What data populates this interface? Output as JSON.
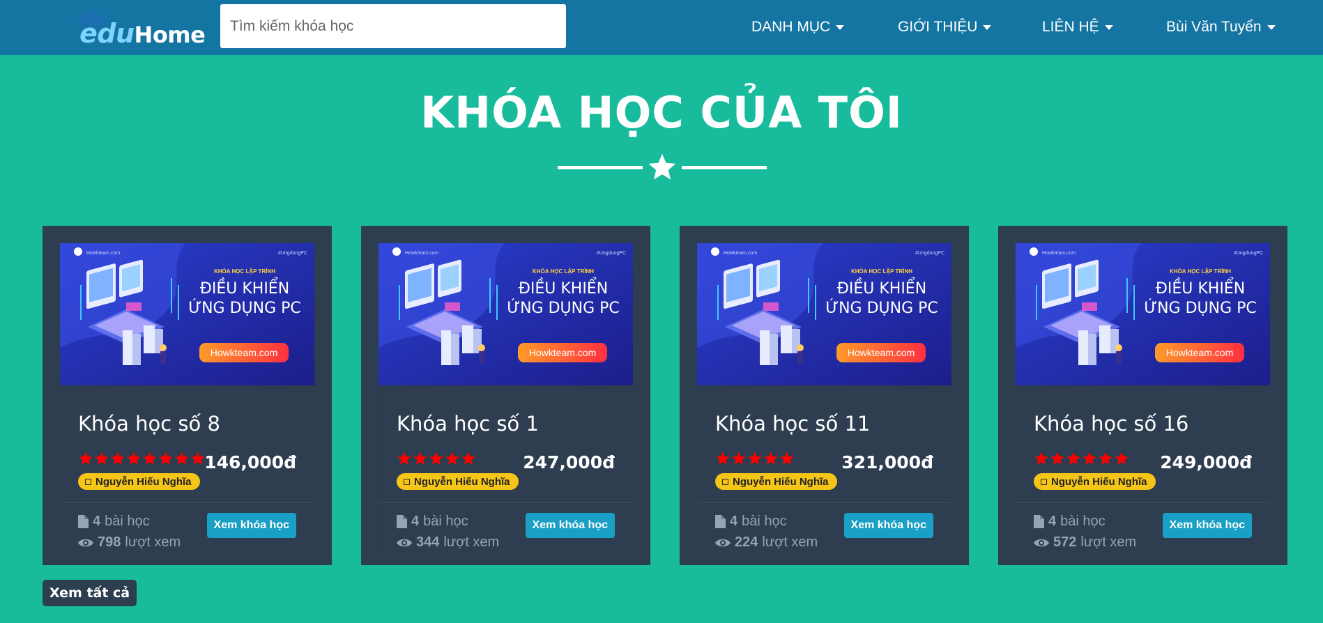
{
  "brand": {
    "logo_prefix": "edu",
    "logo_suffix": "Home"
  },
  "search": {
    "placeholder": "Tìm kiếm khóa học"
  },
  "nav": {
    "items": [
      {
        "label": "DANH MỤC"
      },
      {
        "label": "GIỚI THIỆU"
      },
      {
        "label": "LIÊN HỆ"
      },
      {
        "label": "Bùi Văn Tuyển"
      }
    ]
  },
  "page": {
    "title": "KHÓA HỌC CỦA TÔI"
  },
  "banner": {
    "site_small": "Howkteam.com",
    "hashtag": "#UngdungPC",
    "kicker": "KHÓA HỌC LẬP TRÌNH",
    "line1": "ĐIỀU KHIỂN",
    "line2": "ỨNG DỤNG PC",
    "button": "Howkteam.com"
  },
  "courses": [
    {
      "title": "Khóa học số 8",
      "price": "146,000đ",
      "stars": 8,
      "author": "Nguyễn Hiếu Nghĩa",
      "lessons_num": "4",
      "lessons_label": "bài học",
      "views_num": "798",
      "views_label": "lượt xem",
      "button": "Xem khóa học"
    },
    {
      "title": "Khóa học số 1",
      "price": "247,000đ",
      "stars": 5,
      "author": "Nguyễn Hiếu Nghĩa",
      "lessons_num": "4",
      "lessons_label": "bài học",
      "views_num": "344",
      "views_label": "lượt xem",
      "button": "Xem khóa học"
    },
    {
      "title": "Khóa học số 11",
      "price": "321,000đ",
      "stars": 5,
      "author": "Nguyễn Hiếu Nghĩa",
      "lessons_num": "4",
      "lessons_label": "bài học",
      "views_num": "224",
      "views_label": "lượt xem",
      "button": "Xem khóa học"
    },
    {
      "title": "Khóa học số 16",
      "price": "249,000đ",
      "stars": 6,
      "author": "Nguyễn Hiếu Nghĩa",
      "lessons_num": "4",
      "lessons_label": "bài học",
      "views_num": "572",
      "views_label": "lượt xem",
      "button": "Xem khóa học"
    }
  ],
  "footer": {
    "view_all": "Xem tất cả"
  },
  "colors": {
    "background": "#18bc9c",
    "navbar": "#1475a2",
    "card": "#2c3e50",
    "star": "#ff0000",
    "author_badge": "#f5c518",
    "button": "#1aa0c4"
  },
  "icons": {
    "lesson": "file-icon",
    "views": "eye-icon",
    "rating": "star-icon",
    "divider": "star-icon"
  }
}
